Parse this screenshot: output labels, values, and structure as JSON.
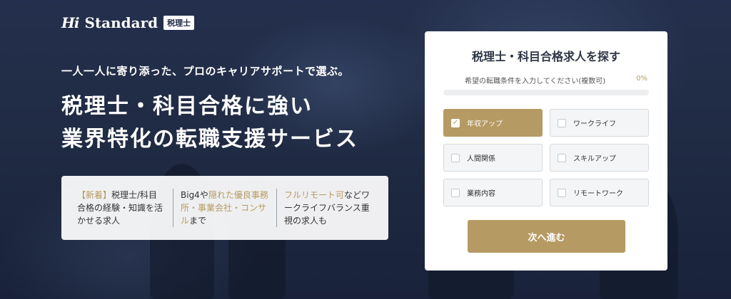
{
  "logo": {
    "mark": "Hi",
    "name": "Standard",
    "badge": "税理士"
  },
  "hero": {
    "tagline": "一人一人に寄り添った、プロのキャリアサポートで選ぶ。",
    "headline_1": "税理士・科目合格に強い",
    "headline_2": "業界特化の転職支援サービス"
  },
  "features": [
    {
      "highlight": "【新着】",
      "text": "税理士/科目合格の経験・知識を活かせる求人"
    },
    {
      "pre": "Big4や",
      "highlight": "隠れた優良事務所・事業会社・コンサル",
      "text": "まで"
    },
    {
      "highlight": "フルリモート可",
      "text": "などワークライフバランス重視の求人も"
    }
  ],
  "panel": {
    "title": "税理士・科目合格求人を探す",
    "subtitle": "希望の転職条件を入力してください(複数可)",
    "progress_label": "0%",
    "progress_value": 0,
    "options": [
      {
        "label": "年収アップ",
        "checked": true
      },
      {
        "label": "ワークライフ",
        "checked": false
      },
      {
        "label": "人間関係",
        "checked": false
      },
      {
        "label": "スキルアップ",
        "checked": false
      },
      {
        "label": "業務内容",
        "checked": false
      },
      {
        "label": "リモートワーク",
        "checked": false
      }
    ],
    "next_label": "次へ進む"
  },
  "colors": {
    "accent": "#b59a63",
    "background": "#1f2a44"
  },
  "icons": {
    "check": "check-icon"
  }
}
